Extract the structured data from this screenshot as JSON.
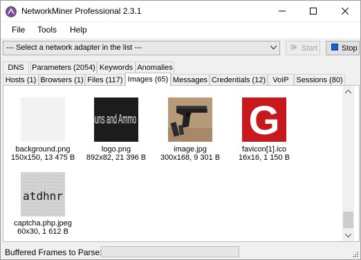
{
  "window": {
    "title": "NetworkMiner Professional 2.3.1"
  },
  "menu": {
    "items": [
      "File",
      "Tools",
      "Help"
    ]
  },
  "toolbar": {
    "adapter_value": "--- Select a network adapter in the list ---",
    "start_label": "Start",
    "stop_label": "Stop"
  },
  "tabs_top": [
    "DNS",
    "Parameters (2054)",
    "Keywords",
    "Anomalies"
  ],
  "tabs_bottom": [
    "Hosts (1)",
    "Browsers (1)",
    "Files (117)",
    "Images (65)",
    "Messages",
    "Credentials (12)",
    "VoIP",
    "Sessions (80)"
  ],
  "selected_tab": "Images (65)",
  "images": [
    {
      "name": "background.png",
      "info": "150x150, 13 475 B"
    },
    {
      "name": "logo.png",
      "info": "892x82, 21 396 B",
      "thumb_text": "UK Guns and Ammo Store"
    },
    {
      "name": "image.jpg",
      "info": "300x168, 9 301 B"
    },
    {
      "name": "favicon[1].ico",
      "info": "16x16, 1 150 B",
      "thumb_text": "G"
    },
    {
      "name": "captcha.php.jpeg",
      "info": "60x30, 1 612 B",
      "thumb_text": "atdhnr"
    }
  ],
  "status": {
    "label": "Buffered Frames to Parse:"
  },
  "colors": {
    "favicon_red": "#c8181c",
    "stop_icon": "#1e5fd0",
    "app_icon": "#7a4b93"
  }
}
